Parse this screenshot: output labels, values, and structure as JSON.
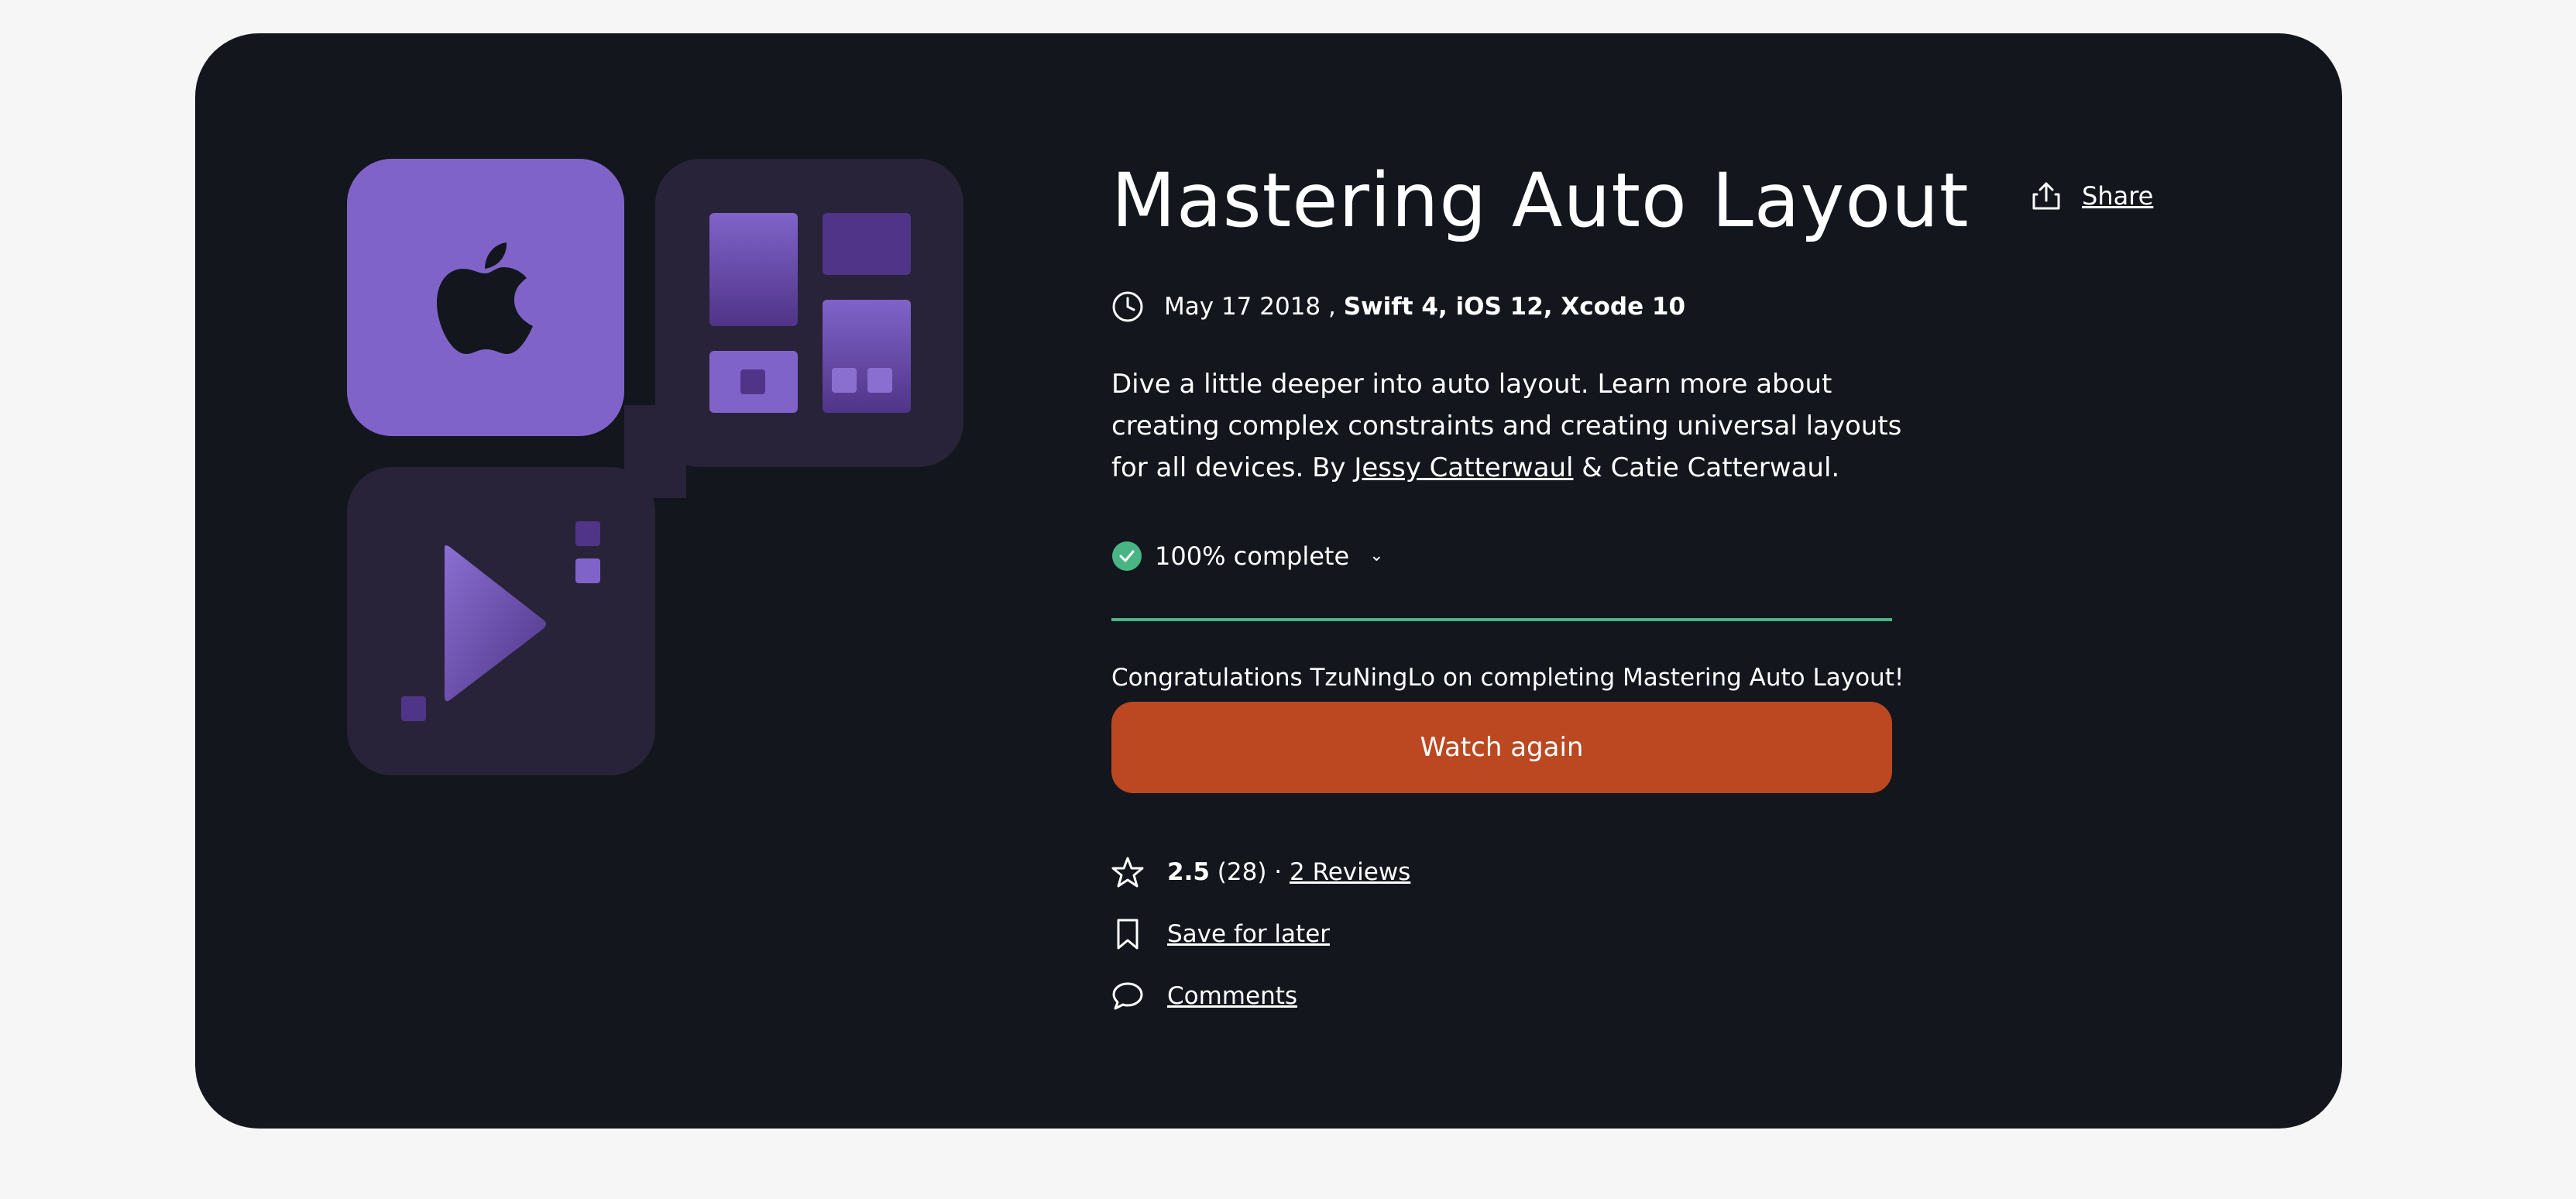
{
  "course": {
    "title": "Mastering Auto Layout",
    "share_label": "Share",
    "date": "May 17 2018",
    "date_separator": ",",
    "platforms": "Swift 4, iOS 12, Xcode 10",
    "description_prefix": "Dive a little deeper into auto layout. Learn more about creating complex constraints and creating universal layouts for all devices. By ",
    "author_link": "Jessy Catterwaul",
    "description_suffix": " & Catie Catterwaul.",
    "progress_label": "100% complete",
    "progress_percent": 100,
    "congrats_text": "Congratulations TzuNingLo on completing Mastering Auto Layout!",
    "watch_button": "Watch again",
    "rating": "2.5",
    "rating_count": "(28)",
    "rating_separator": "·",
    "reviews_link": "2 Reviews",
    "save_label": "Save for later",
    "comments_label": "Comments"
  },
  "icons": [
    "apple-logo-icon",
    "share-icon",
    "clock-icon",
    "check-circle-icon",
    "chevron-down-icon",
    "star-icon",
    "bookmark-icon",
    "comment-icon"
  ],
  "colors": {
    "page_bg": "#f6f6f6",
    "card_bg": "#13161d",
    "accent_purple": "#8063c9",
    "tile_dark": "#282338",
    "progress_green": "#49b584",
    "button_orange": "#bb4820"
  }
}
